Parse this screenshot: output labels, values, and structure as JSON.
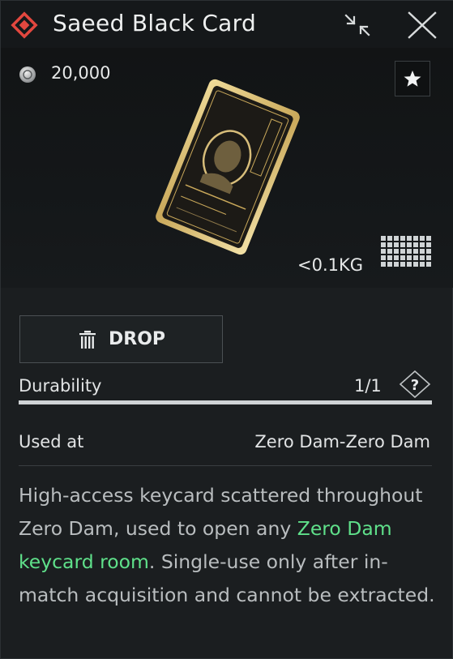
{
  "header": {
    "title": "Saeed Black Card",
    "rarity_color": "#e2473f"
  },
  "item": {
    "price": "20,000",
    "weight": "<0.1KG"
  },
  "actions": {
    "drop_label": "DROP"
  },
  "durability": {
    "label": "Durability",
    "value": "1/1",
    "help": "?",
    "fraction": 1.0
  },
  "used_at": {
    "label": "Used at",
    "value": "Zero Dam-Zero Dam"
  },
  "description": {
    "before": "High-access keycard scattered throughout Zero Dam, used to open any ",
    "highlight": "Zero Dam keycard room",
    "after": ". Single-use only after in-match acquisition and cannot be extracted.",
    "highlight_color": "#5fe08a"
  },
  "icons": [
    "rarity-diamond-icon",
    "collapse-icon",
    "close-icon",
    "coin-icon",
    "star-icon",
    "card-image",
    "grid-size-icon",
    "trash-icon",
    "help-icon"
  ]
}
